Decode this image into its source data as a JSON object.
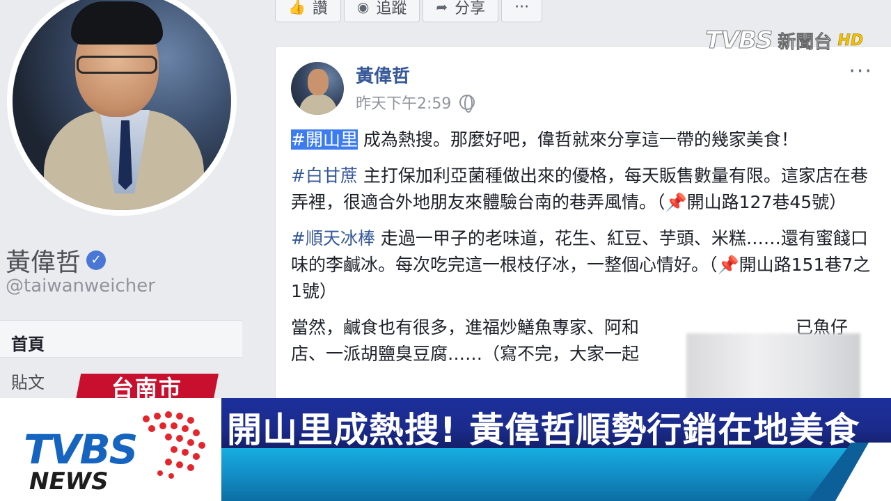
{
  "profile": {
    "name": "黃偉哲",
    "handle": "@taiwanweicher",
    "nav_home": "首頁",
    "nav_posts": "貼文"
  },
  "action_bar": {
    "like": "讚",
    "follow": "追蹤",
    "share": "分享",
    "more": "···"
  },
  "channel_bug": {
    "logo": "TVBS",
    "channel": "新聞台",
    "hd": "HD"
  },
  "post": {
    "author": "黃偉哲",
    "timestamp": "昨天下午2:59",
    "more": "···",
    "paragraphs": [
      {
        "hashtag": "#開山里",
        "text": " 成為熱搜。那麼好吧，偉哲就來分享這一帶的幾家美食！"
      },
      {
        "hashtag": "#白甘蔗",
        "text": " 主打保加利亞菌種做出來的優格，每天販售數量有限。這家店在巷弄裡，很適合外地朋友來體驗台南的巷弄風情。（",
        "pin": "📌",
        "tail": "開山路127巷45號）"
      },
      {
        "hashtag": "#順天冰棒",
        "text": " 走過一甲子的老味道，花生、紅豆、芋頭、米糕……還有蜜餞口味的李鹹冰。每次吃完這一根枝仔冰，一整個心情好。（",
        "pin": "📌",
        "tail": "開山路151巷7之1號）"
      },
      {
        "text": "當然，鹹食也有很多，進福炒鱔魚專家、阿和　　　　　　　　　已魚仔店、一派胡鹽臭豆腐……（寫不完，大家一起"
      }
    ]
  },
  "lower_third": {
    "location": "台南市",
    "logo_tvbs": "TVBS",
    "logo_news": "NEWS",
    "headline": "開山里成熱搜! 黃偉哲順勢行銷在地美食"
  },
  "colors": {
    "headline_bg": "#1c2f9c",
    "ticker_bg": "#16aee0",
    "location_bg": "#c8102e",
    "hashtag": "#365899",
    "selection": "#3d7cf0"
  }
}
